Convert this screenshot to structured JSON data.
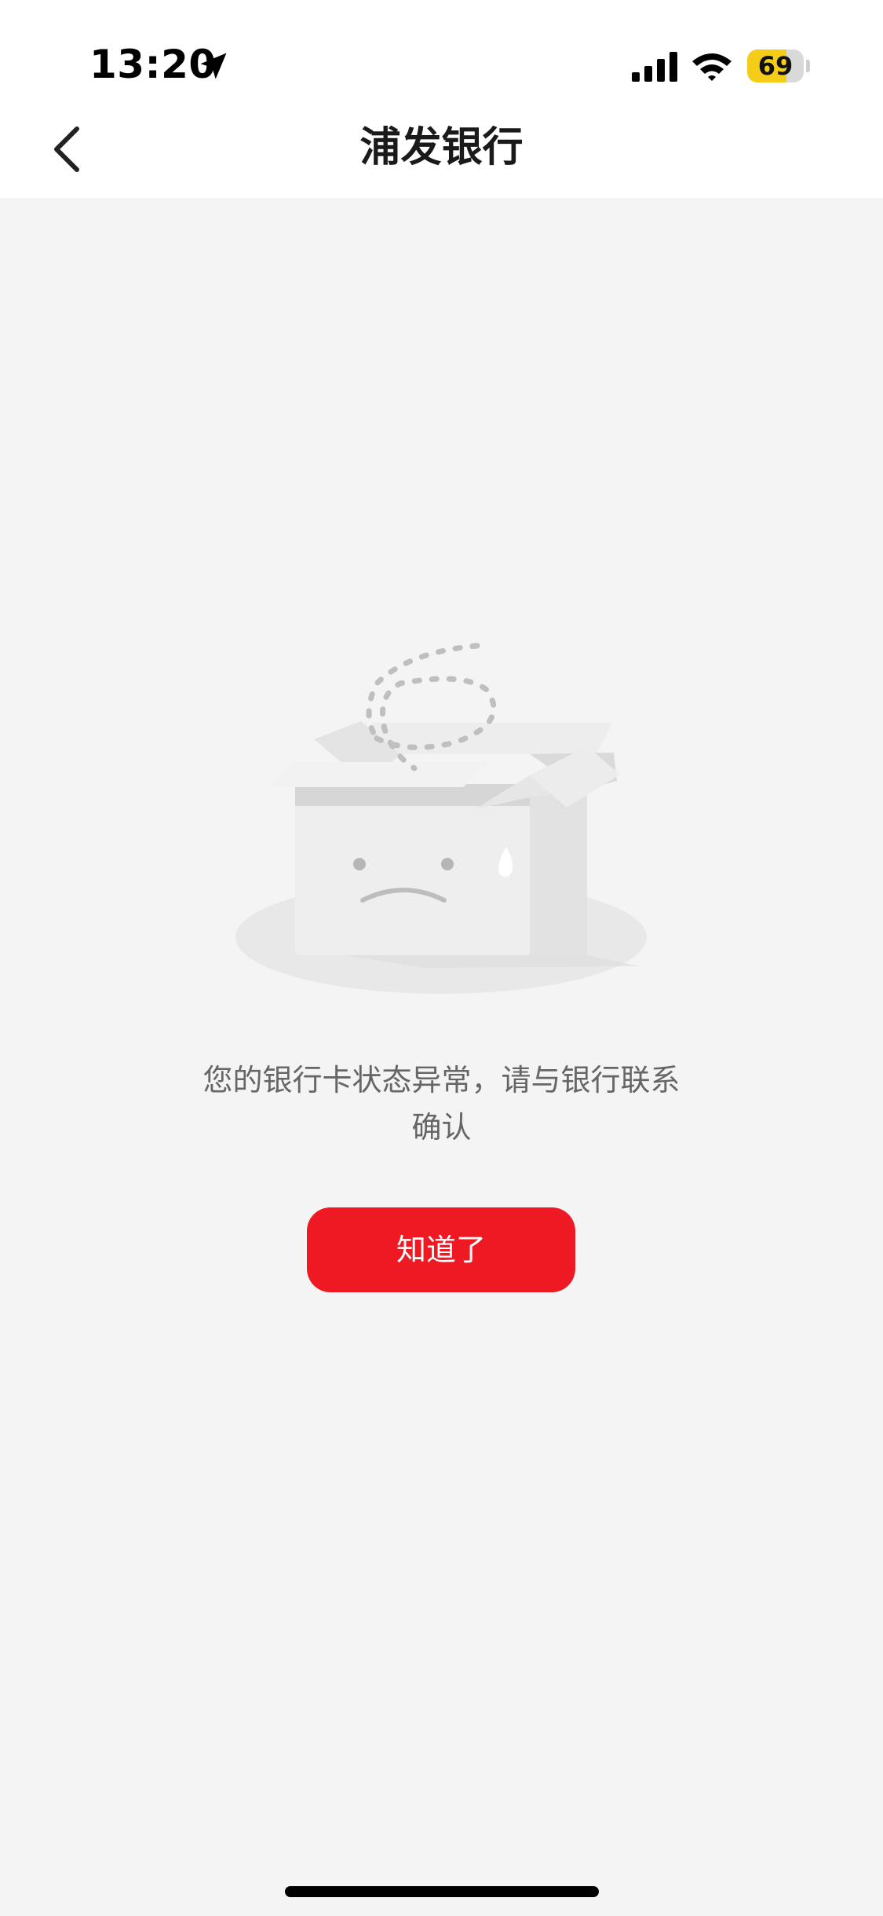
{
  "status_bar": {
    "time": "13:20",
    "battery_level": "69",
    "battery_fraction": 0.69,
    "icons": [
      "location-arrow-icon",
      "cellular-signal-icon",
      "wifi-icon",
      "battery-icon"
    ]
  },
  "nav": {
    "title": "浦发银行",
    "back_icon": "chevron-left-icon"
  },
  "empty_state": {
    "illustration": "empty-box-sad-face",
    "message_lines": [
      "您的银行卡状态异常，请与银行联系",
      "确认"
    ],
    "button_label": "知道了"
  },
  "colors": {
    "accent": "#ee1923",
    "background": "#f4f4f4",
    "header_background": "#ffffff",
    "message_text": "#666666",
    "battery": "#f5cc18"
  }
}
